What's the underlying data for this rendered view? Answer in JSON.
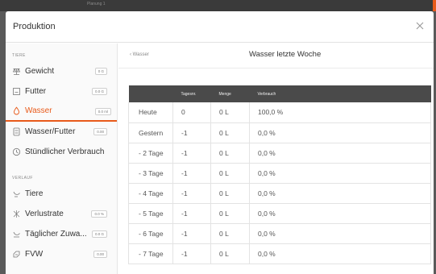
{
  "topbar": {
    "label": "Planung 1"
  },
  "modal": {
    "title": "Produktion"
  },
  "sidebar": {
    "section_tiere": "TIERE",
    "section_verlauf": "VERLAUF",
    "items_tiere": [
      {
        "label": "Gewicht",
        "badge": "0 G",
        "icon": "scale-icon"
      },
      {
        "label": "Futter",
        "badge": "0.0 G",
        "icon": "feed-icon"
      },
      {
        "label": "Wasser",
        "badge": "0.0 ml",
        "icon": "water-drop-icon",
        "active": true
      },
      {
        "label": "Wasser/Futter",
        "badge": "0.00",
        "icon": "ratio-icon"
      },
      {
        "label": "Stündlicher Verbrauch",
        "badge": "",
        "icon": "clock-icon"
      }
    ],
    "items_verlauf": [
      {
        "label": "Tiere",
        "badge": "",
        "icon": "bird-icon"
      },
      {
        "label": "Verlustrate",
        "badge": "0.0 %",
        "icon": "loss-icon"
      },
      {
        "label": "Täglicher Zuwa...",
        "badge": "0.0 G",
        "icon": "growth-icon"
      },
      {
        "label": "FVW",
        "badge": "0.00",
        "icon": "fvw-icon"
      }
    ]
  },
  "main": {
    "back_label": "‹ Wasser",
    "title": "Wasser letzte Woche",
    "table": {
      "headers": [
        "",
        "Tagesnr.",
        "Menge",
        "Verbrauch"
      ],
      "rows": [
        [
          "Heute",
          "0",
          "0 L",
          "100,0 %"
        ],
        [
          "Gestern",
          "-1",
          "0 L",
          "0,0 %"
        ],
        [
          "- 2 Tage",
          "-1",
          "0 L",
          "0,0 %"
        ],
        [
          "- 3 Tage",
          "-1",
          "0 L",
          "0,0 %"
        ],
        [
          "- 4 Tage",
          "-1",
          "0 L",
          "0,0 %"
        ],
        [
          "- 5 Tage",
          "-1",
          "0 L",
          "0,0 %"
        ],
        [
          "- 6 Tage",
          "-1",
          "0 L",
          "0,0 %"
        ],
        [
          "- 7 Tage",
          "-1",
          "0 L",
          "0,0 %"
        ]
      ]
    }
  },
  "colors": {
    "accent": "#e85a1a",
    "table_header": "#4a4a4a",
    "backdrop": "#5a5a5a"
  }
}
